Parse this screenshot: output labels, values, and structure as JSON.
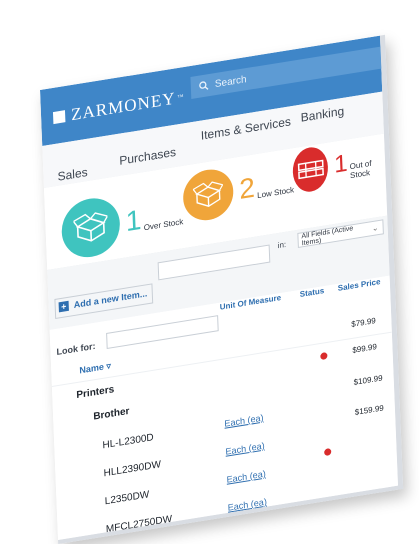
{
  "app": {
    "logo_text": "ZARMONEY",
    "logo_tm": "™",
    "search_placeholder": "Search"
  },
  "nav": {
    "tabs": [
      {
        "label": "Sales"
      },
      {
        "label": "Purchases"
      },
      {
        "label": "Items & Services"
      },
      {
        "label": "Banking"
      }
    ]
  },
  "stats": [
    {
      "value": "1",
      "label": "Over Stock",
      "color": "#3fc4bf",
      "icon": "open-box-icon"
    },
    {
      "value": "2",
      "label": "Low Stock",
      "color": "#f0a53a",
      "icon": "open-box-icon"
    },
    {
      "value": "1",
      "label": "Out of Stock",
      "color": "#d92c2c",
      "icon": "pallet-icon"
    }
  ],
  "filters": {
    "in_label": "in:",
    "scope_selected": "All Fields (Active Items)",
    "add_item_label": "Add a new Item...",
    "look_for_label": "Look for:"
  },
  "table": {
    "columns": {
      "name": "Name",
      "unit": "Unit Of Measure",
      "status": "Status",
      "price": "Sales Price"
    },
    "rows": [
      {
        "name": "Printers",
        "unit": "",
        "status": "",
        "price": "$79.99"
      },
      {
        "name": "Brother",
        "unit": "",
        "status": "",
        "price": "$99.99"
      },
      {
        "name": "HL-L2300D",
        "unit": "Each (ea)",
        "status": "",
        "price": "$109.99"
      },
      {
        "name": "HLL2390DW",
        "unit": "Each (ea)",
        "status": "",
        "price": "$159.99"
      },
      {
        "name": "L2350DW",
        "unit": "Each (ea)",
        "status": "",
        "price": ""
      },
      {
        "name": "MFCL2750DW",
        "unit": "Each (ea)",
        "status": "",
        "price": ""
      }
    ]
  }
}
